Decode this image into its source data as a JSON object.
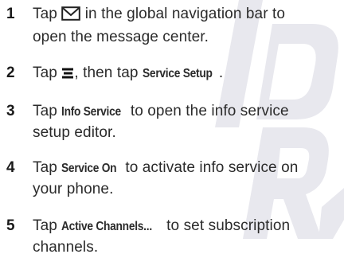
{
  "watermark": {
    "text": "DRAFT",
    "color": "#e8e8ee"
  },
  "steps": [
    {
      "num": "1",
      "pre": "Tap",
      "icon": "envelope-icon",
      "post_line1": "in the global navigation bar to",
      "line2": "open the message center."
    },
    {
      "num": "2",
      "pre": "Tap",
      "icon": "menu-icon",
      "mid": ", then tap",
      "bold": "Service Setup",
      "end": "."
    },
    {
      "num": "3",
      "pre": "Tap",
      "bold": "Info Service",
      "post_line1": "to open the info service",
      "line2": "setup editor."
    },
    {
      "num": "4",
      "pre": "Tap",
      "bold": "Service On",
      "post_line1": "to activate info service on",
      "line2": "your phone."
    },
    {
      "num": "5",
      "pre": "Tap",
      "bold": "Active Channels...",
      "post_line1": "to set subscription",
      "line2": "channels."
    }
  ]
}
